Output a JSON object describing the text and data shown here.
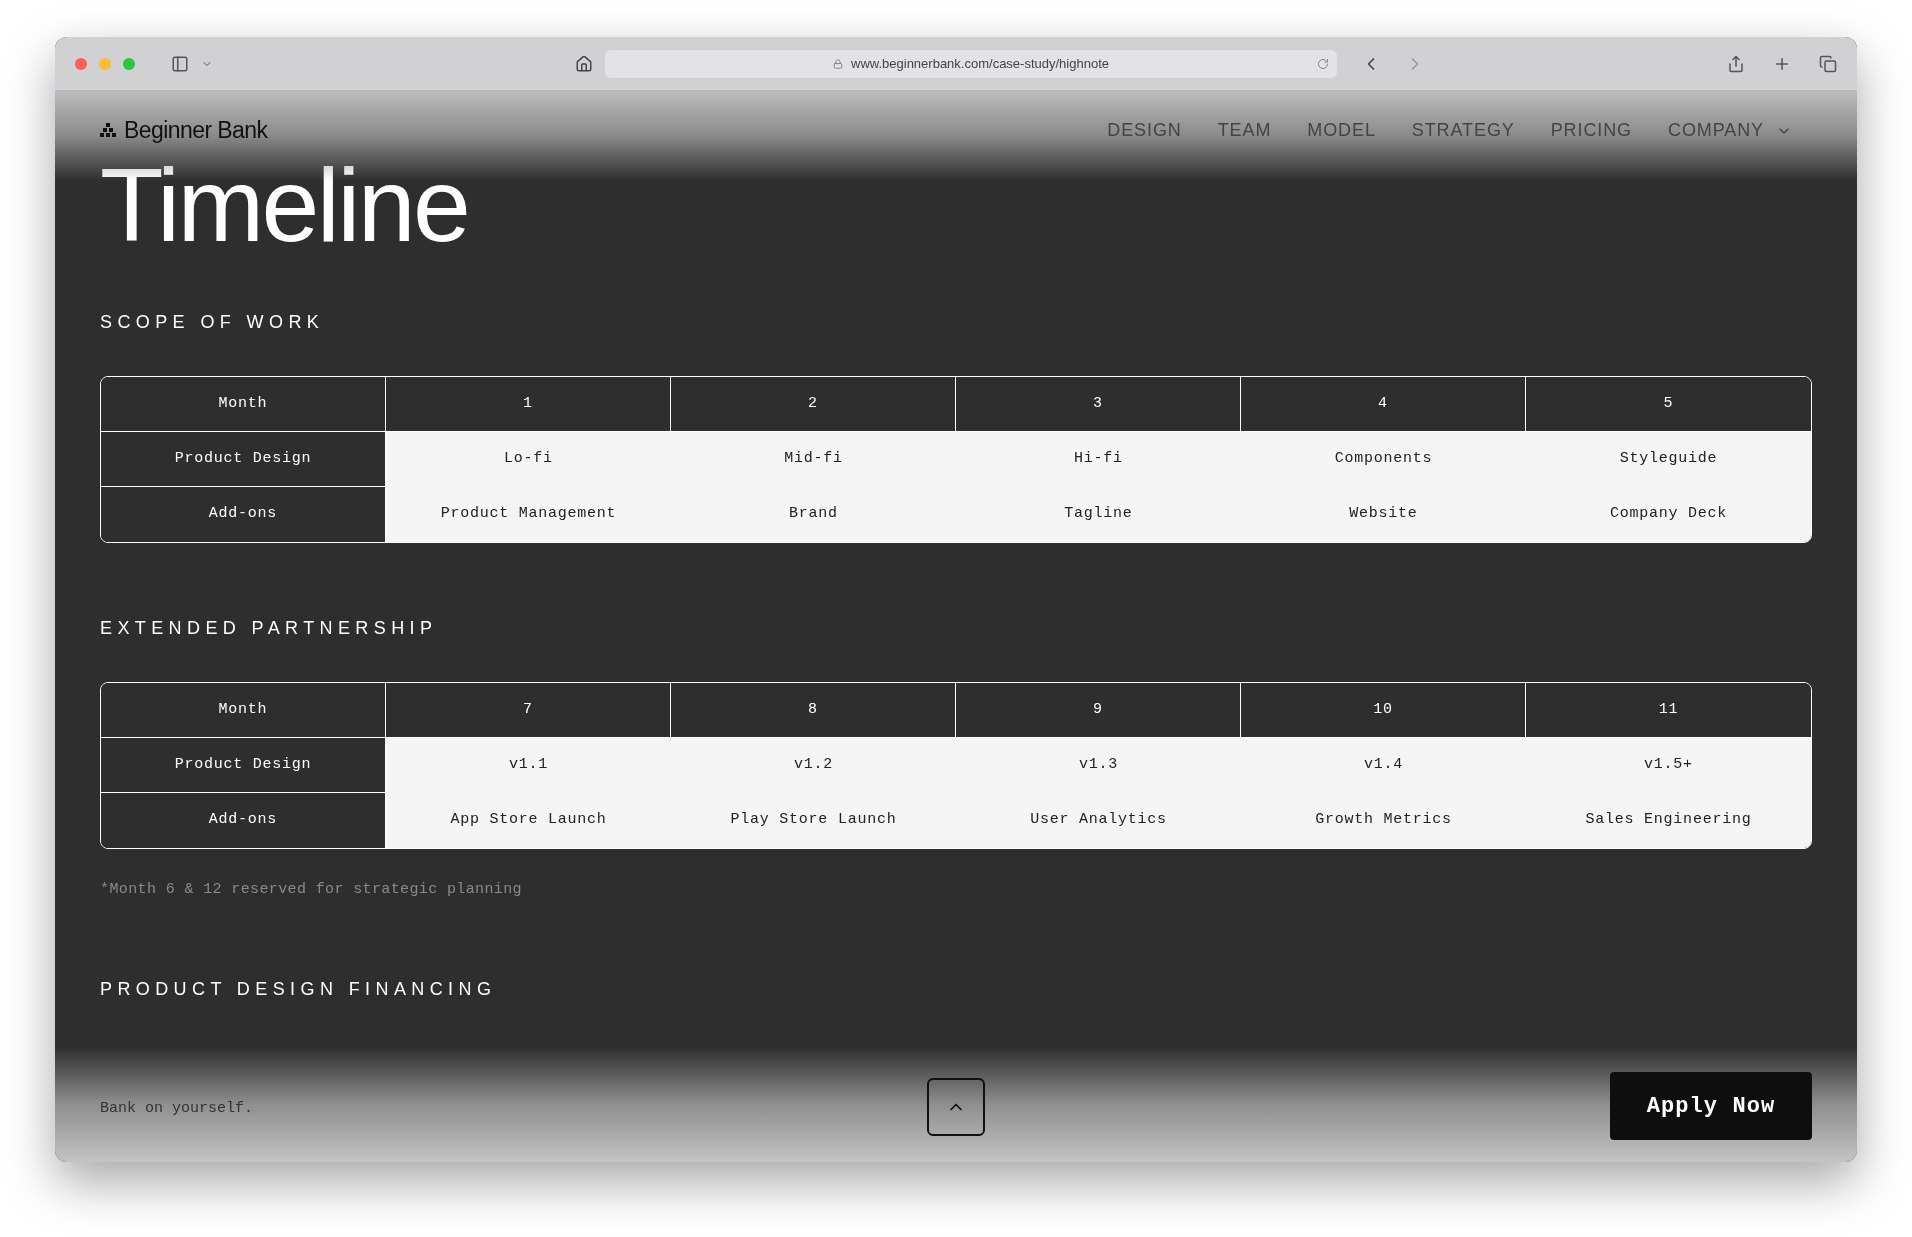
{
  "browser": {
    "url": "www.beginnerbank.com/case-study/highnote"
  },
  "header": {
    "logo": "Beginner Bank",
    "nav": [
      {
        "label": "DESIGN",
        "kind": "link"
      },
      {
        "label": "TEAM",
        "kind": "link"
      },
      {
        "label": "MODEL",
        "kind": "link"
      },
      {
        "label": "STRATEGY",
        "kind": "link"
      },
      {
        "label": "PRICING",
        "kind": "link"
      },
      {
        "label": "COMPANY",
        "kind": "dropdown"
      }
    ]
  },
  "title": "Timeline",
  "sections": [
    {
      "heading": "SCOPE OF WORK",
      "table": {
        "corner": "Month",
        "columns": [
          "1",
          "2",
          "3",
          "4",
          "5"
        ],
        "rows": [
          {
            "label": "Product Design",
            "cells": [
              "Lo-fi",
              "Mid-fi",
              "Hi-fi",
              "Components",
              "Styleguide"
            ]
          },
          {
            "label": "Add-ons",
            "cells": [
              "Product Management",
              "Brand",
              "Tagline",
              "Website",
              "Company Deck"
            ]
          }
        ]
      }
    },
    {
      "heading": "EXTENDED PARTNERSHIP",
      "table": {
        "corner": "Month",
        "columns": [
          "7",
          "8",
          "9",
          "10",
          "11"
        ],
        "rows": [
          {
            "label": "Product Design",
            "cells": [
              "v1.1",
              "v1.2",
              "v1.3",
              "v1.4",
              "v1.5+"
            ]
          },
          {
            "label": "Add-ons",
            "cells": [
              "App Store Launch",
              "Play Store Launch",
              "User Analytics",
              "Growth Metrics",
              "Sales Engineering"
            ]
          }
        ]
      }
    }
  ],
  "footnote": "*Month 6 & 12 reserved for strategic planning",
  "next_heading": "PRODUCT DESIGN FINANCING",
  "footer": {
    "tagline": "Bank on yourself.",
    "cta": "Apply Now"
  }
}
